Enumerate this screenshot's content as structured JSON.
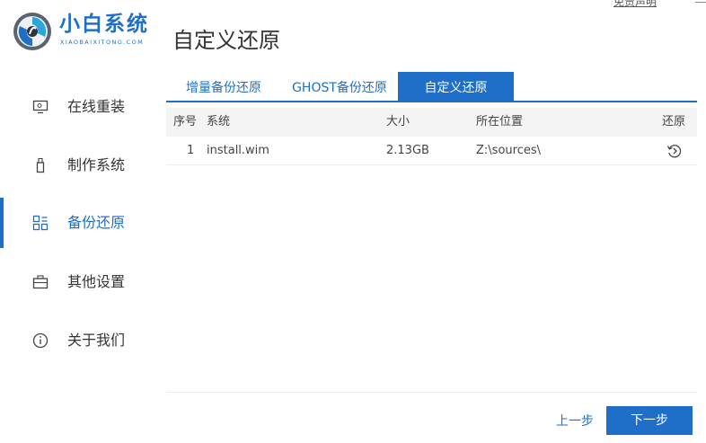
{
  "brand": {
    "name": "小白系统",
    "subtitle": "XIAOBAIXITONG.COM",
    "color": "#1f6fc8"
  },
  "topbar": {
    "disclaimer": "免责声明",
    "minimize_icon": "minimize-icon"
  },
  "page": {
    "title": "自定义还原"
  },
  "sidebar": {
    "items": [
      {
        "label": "在线重装",
        "icon": "monitor-icon",
        "active": false
      },
      {
        "label": "制作系统",
        "icon": "usb-drive-icon",
        "active": false
      },
      {
        "label": "备份还原",
        "icon": "backup-grid-icon",
        "active": true
      },
      {
        "label": "其他设置",
        "icon": "briefcase-icon",
        "active": false
      },
      {
        "label": "关于我们",
        "icon": "info-icon",
        "active": false
      }
    ]
  },
  "tabs": [
    {
      "label": "增量备份还原",
      "active": false
    },
    {
      "label": "GHOST备份还原",
      "active": false
    },
    {
      "label": "自定义还原",
      "active": true
    }
  ],
  "table": {
    "headers": {
      "index": "序号",
      "system": "系统",
      "size": "大小",
      "location": "所在位置",
      "restore": "还原"
    },
    "rows": [
      {
        "index": "1",
        "system": "install.wim",
        "size": "2.13GB",
        "location": "Z:\\sources\\",
        "restore_icon": "restore-icon"
      }
    ]
  },
  "footer": {
    "prev_label": "上一步",
    "next_label": "下一步"
  }
}
